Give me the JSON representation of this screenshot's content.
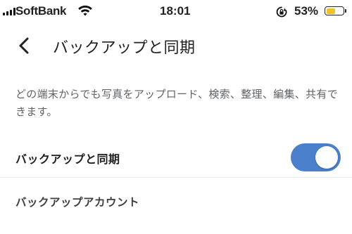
{
  "status_bar": {
    "carrier": "SoftBank",
    "time": "18:01",
    "battery_percent": "53%",
    "battery_level": 0.53,
    "battery_color": "#f2c027",
    "signal_icon": "cellular-signal-icon",
    "wifi_icon": "wifi-icon",
    "rotation_icon": "rotation-lock-icon"
  },
  "header": {
    "back_icon": "chevron-left-icon",
    "title": "バックアップと同期"
  },
  "description": "どの端末からでも写真をアップロード、検索、整理、編集、共有できます。",
  "settings": {
    "sync_row": {
      "label": "バックアップと同期",
      "enabled": true,
      "toggle_color": "#4a7fcb"
    },
    "account_row": {
      "label": "バックアップアカウント"
    }
  }
}
